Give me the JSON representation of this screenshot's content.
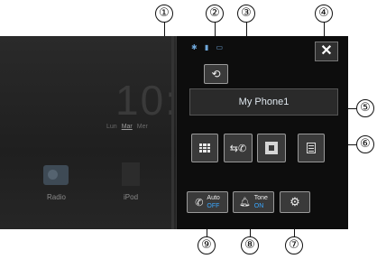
{
  "callouts": [
    "①",
    "②",
    "③",
    "④",
    "⑤",
    "⑥",
    "⑦",
    "⑧",
    "⑨"
  ],
  "home": {
    "clock": "10:",
    "days": [
      "Lun",
      "Mar",
      "Mer"
    ],
    "tiles": [
      "Radio",
      "iPod"
    ]
  },
  "panel": {
    "device_name": "My Phone1",
    "auto_answer": {
      "label": "Auto",
      "state": "OFF"
    },
    "ringtone": {
      "label": "Tone",
      "state": "ON"
    }
  },
  "icons": {
    "close": "close-icon",
    "voice": "voice-recognition-icon",
    "keypad": "keypad-icon",
    "call_history": "call-history-icon",
    "phonebook": "phonebook-icon",
    "preset_dial": "preset-dial-icon",
    "bell": "bell-icon",
    "settings": "gear-icon"
  },
  "colors": {
    "accent": "#39a7ff",
    "panel": "#0d0d0d"
  }
}
